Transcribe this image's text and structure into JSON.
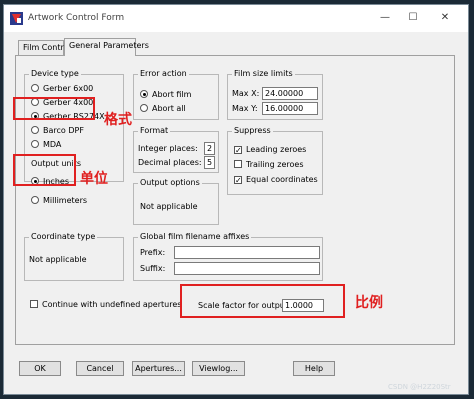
{
  "window": {
    "title": "Artwork Control Form",
    "controls": {
      "minimize": "—",
      "maximize": "☐",
      "close": "✕"
    }
  },
  "tabs": [
    {
      "label": "Film Control",
      "active": false
    },
    {
      "label": "General Parameters",
      "active": true
    }
  ],
  "device_type": {
    "title": "Device type",
    "options": [
      "Gerber 6x00",
      "Gerber 4x00",
      "Gerber RS274X",
      "Barco DPF",
      "MDA"
    ],
    "selected": "Gerber RS274X"
  },
  "output_units": {
    "title": "Output units",
    "options": [
      "Inches",
      "Millimeters"
    ],
    "selected": "Inches"
  },
  "error_action": {
    "title": "Error action",
    "options": [
      "Abort film",
      "Abort all"
    ],
    "selected": "Abort film"
  },
  "film_size_limits": {
    "title": "Film size limits",
    "max_x_label": "Max X:",
    "max_x_value": "24.00000",
    "max_y_label": "Max Y:",
    "max_y_value": "16.00000"
  },
  "format": {
    "title": "Format",
    "integer_label": "Integer places:",
    "integer_value": "2",
    "decimal_label": "Decimal places:",
    "decimal_value": "5"
  },
  "suppress": {
    "title": "Suppress",
    "items": [
      {
        "label": "Leading zeroes",
        "checked": true
      },
      {
        "label": "Trailing zeroes",
        "checked": false
      },
      {
        "label": "Equal coordinates",
        "checked": true
      }
    ]
  },
  "output_options": {
    "title": "Output options",
    "value": "Not applicable"
  },
  "coordinate_type": {
    "title": "Coordinate type",
    "value": "Not applicable"
  },
  "global_affixes": {
    "title": "Global film filename affixes",
    "prefix_label": "Prefix:",
    "prefix_value": "",
    "suffix_label": "Suffix:",
    "suffix_value": ""
  },
  "continue_undefined": {
    "label": "Continue with undefined apertures",
    "checked": false
  },
  "scale_factor": {
    "label": "Scale factor for output:",
    "value": "1.0000"
  },
  "buttons": {
    "ok": "OK",
    "cancel": "Cancel",
    "apertures": "Apertures...",
    "viewlog": "Viewlog...",
    "help": "Help"
  },
  "annotations": {
    "format_note": "格式",
    "units_note": "单位",
    "scale_note": "比例",
    "annotation_color": "#e02020"
  },
  "watermark": "CSDN @H2Z20Str"
}
